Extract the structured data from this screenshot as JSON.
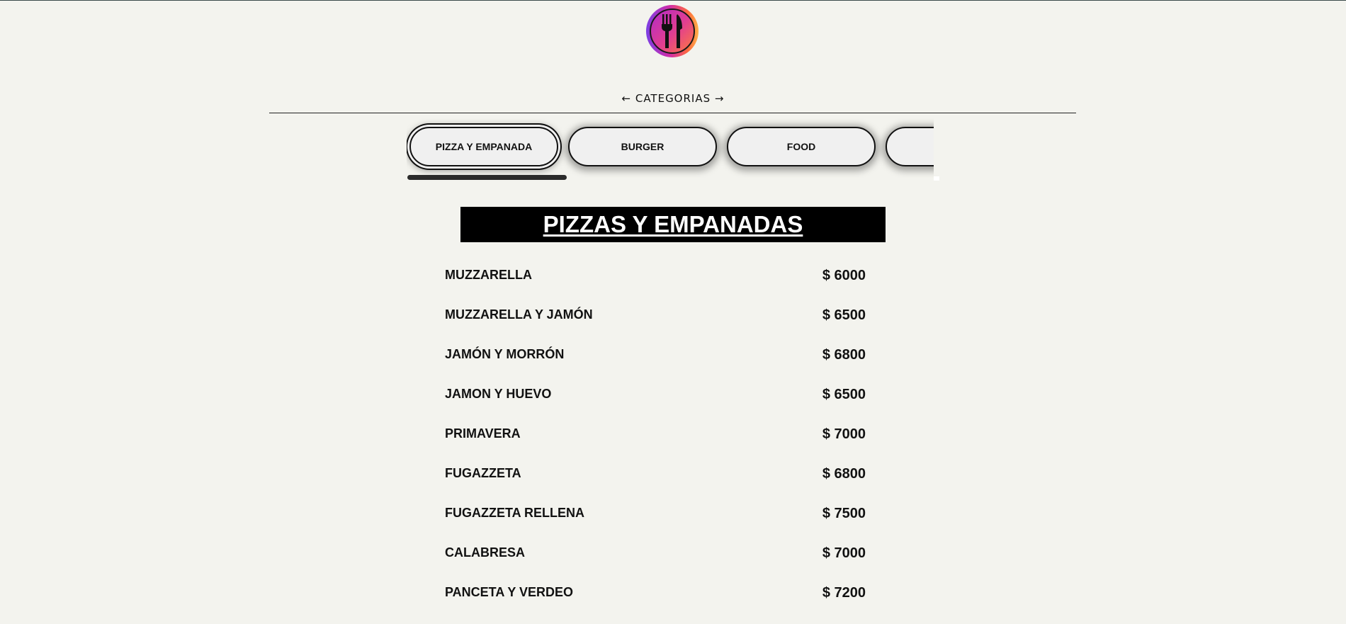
{
  "header": {
    "logo_icon": "fork-knife-icon",
    "categories_label": "← CATEGORIAS →"
  },
  "tabs": [
    {
      "label": "PIZZA Y EMPANADA",
      "active": true
    },
    {
      "label": "BURGER",
      "active": false
    },
    {
      "label": "FOOD",
      "active": false
    },
    {
      "label": "",
      "active": false
    }
  ],
  "section": {
    "title": "PIZZAS Y EMPANADAS"
  },
  "items": [
    {
      "name": "MUZZARELLA",
      "price": "$ 6000"
    },
    {
      "name": "MUZZARELLA Y JAMÓN",
      "price": "$ 6500"
    },
    {
      "name": "JAMÓN Y MORRÓN",
      "price": "$ 6800"
    },
    {
      "name": "JAMON Y HUEVO",
      "price": "$ 6500"
    },
    {
      "name": "PRIMAVERA",
      "price": "$ 7000"
    },
    {
      "name": "FUGAZZETA",
      "price": "$ 6800"
    },
    {
      "name": "FUGAZZETA RELLENA",
      "price": "$ 7500"
    },
    {
      "name": "CALABRESA",
      "price": "$ 7000"
    },
    {
      "name": "PANCETA Y VERDEO",
      "price": "$ 7200"
    }
  ],
  "colors": {
    "background": "#f3f3ee",
    "title_bg": "#000000",
    "logo_gradient_start": "#7b3fe4",
    "logo_gradient_end": "#ffb14a"
  }
}
